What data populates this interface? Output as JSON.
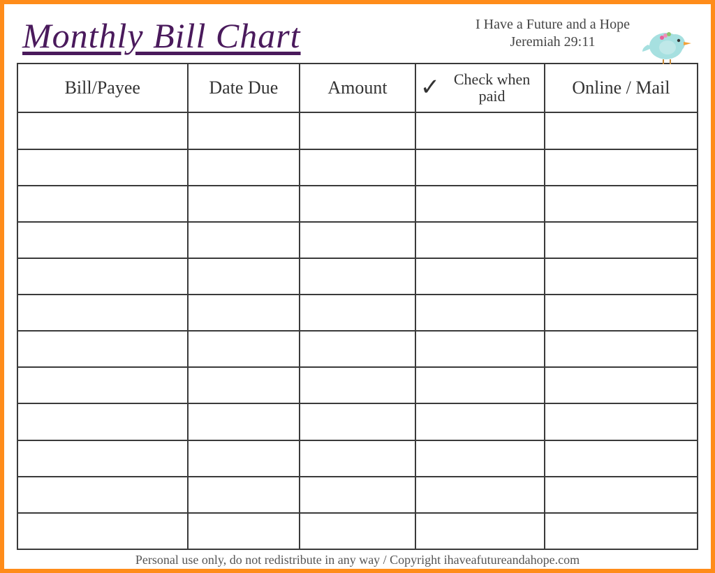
{
  "header": {
    "title": "Monthly Bill Chart",
    "tagline_line1": "I Have a Future and a Hope",
    "tagline_line2": "Jeremiah 29:11"
  },
  "columns": {
    "payee": "Bill/Payee",
    "date_due": "Date Due",
    "amount": "Amount",
    "check_paid": "Check when paid",
    "online_mail": "Online / Mail"
  },
  "checkmark_glyph": "✓",
  "row_count": 12,
  "chart_data": {
    "type": "table",
    "title": "Monthly Bill Chart",
    "columns": [
      "Bill/Payee",
      "Date Due",
      "Amount",
      "Check when paid",
      "Online / Mail"
    ],
    "rows": [
      [
        "",
        "",
        "",
        "",
        ""
      ],
      [
        "",
        "",
        "",
        "",
        ""
      ],
      [
        "",
        "",
        "",
        "",
        ""
      ],
      [
        "",
        "",
        "",
        "",
        ""
      ],
      [
        "",
        "",
        "",
        "",
        ""
      ],
      [
        "",
        "",
        "",
        "",
        ""
      ],
      [
        "",
        "",
        "",
        "",
        ""
      ],
      [
        "",
        "",
        "",
        "",
        ""
      ],
      [
        "",
        "",
        "",
        "",
        ""
      ],
      [
        "",
        "",
        "",
        "",
        ""
      ],
      [
        "",
        "",
        "",
        "",
        ""
      ],
      [
        "",
        "",
        "",
        "",
        ""
      ]
    ]
  },
  "footer": "Personal use only, do not redistribute in any way / Copyright ihaveafutureandahope.com"
}
